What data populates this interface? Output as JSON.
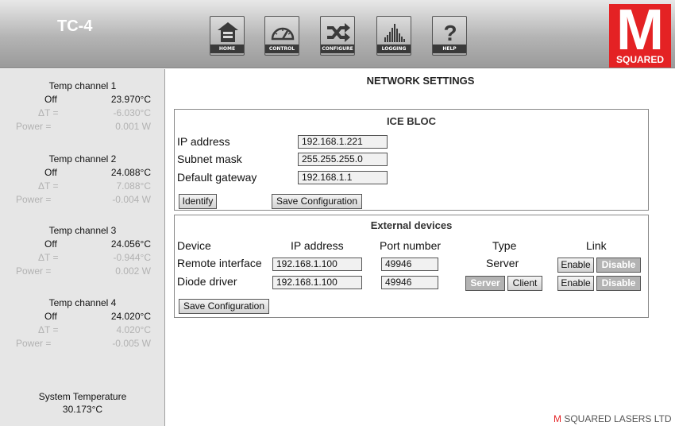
{
  "header": {
    "title": "TC-4",
    "nav": [
      {
        "label": "HOME",
        "icon": "home-icon"
      },
      {
        "label": "CONTROL",
        "icon": "gauge-icon"
      },
      {
        "label": "CONFIGURE",
        "icon": "shuffle-icon"
      },
      {
        "label": "LOGGING",
        "icon": "bar-chart-icon"
      },
      {
        "label": "HELP",
        "icon": "question-icon"
      }
    ],
    "logo": {
      "letter": "M",
      "text": "SQUARED",
      "color": "#e42224"
    }
  },
  "sidebar": {
    "channels": [
      {
        "title": "Temp channel 1",
        "state": "Off",
        "temp": "23.970°C",
        "delta_label": "ΔT =",
        "delta": "-6.030°C",
        "power_label": "Power =",
        "power": "0.001 W"
      },
      {
        "title": "Temp channel 2",
        "state": "Off",
        "temp": "24.088°C",
        "delta_label": "ΔT =",
        "delta": "7.088°C",
        "power_label": "Power =",
        "power": "-0.004 W"
      },
      {
        "title": "Temp channel 3",
        "state": "Off",
        "temp": "24.056°C",
        "delta_label": "ΔT =",
        "delta": "-0.944°C",
        "power_label": "Power =",
        "power": "0.002 W"
      },
      {
        "title": "Temp channel 4",
        "state": "Off",
        "temp": "24.020°C",
        "delta_label": "ΔT =",
        "delta": "4.020°C",
        "power_label": "Power =",
        "power": "-0.005 W"
      }
    ],
    "system_temp_label": "System Temperature",
    "system_temp_value": "30.173°C"
  },
  "main": {
    "title": "NETWORK SETTINGS",
    "ice_bloc": {
      "title": "ICE BLOC",
      "ip_label": "IP address",
      "ip_value": "192.168.1.221",
      "subnet_label": "Subnet mask",
      "subnet_value": "255.255.255.0",
      "gateway_label": "Default gateway",
      "gateway_value": "192.168.1.1",
      "identify_label": "Identify",
      "save_label": "Save Configuration"
    },
    "external": {
      "title": "External devices",
      "columns": [
        "Device",
        "IP address",
        "Port number",
        "Type",
        "Link"
      ],
      "rows": [
        {
          "device": "Remote interface",
          "ip": "192.168.1.100",
          "port": "49946",
          "type": "Server",
          "enable": "Enable",
          "disable": "Disable"
        },
        {
          "device": "Diode driver",
          "ip": "192.168.1.100",
          "port": "49946",
          "type_server": "Server",
          "type_client": "Client",
          "enable": "Enable",
          "disable": "Disable"
        }
      ],
      "save_label": "Save Configuration"
    }
  },
  "footer": {
    "m": "M",
    "text": "SQUARED LASERS LTD"
  }
}
